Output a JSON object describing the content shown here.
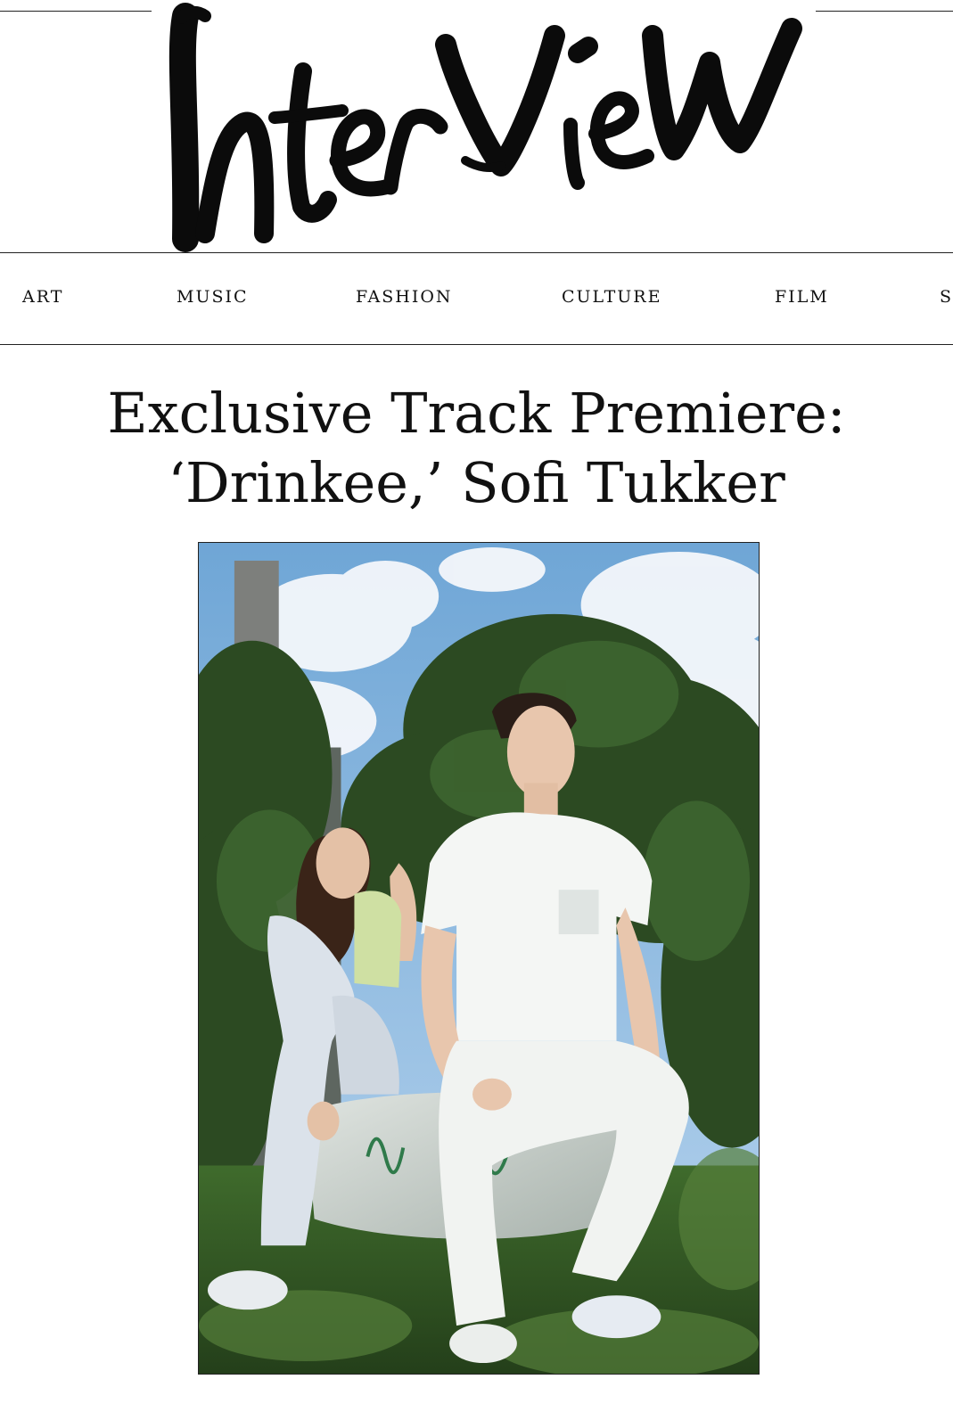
{
  "masthead": {
    "logo_text": "Interview"
  },
  "nav": {
    "items": [
      {
        "label": "ART"
      },
      {
        "label": "MUSIC"
      },
      {
        "label": "FASHION"
      },
      {
        "label": "CULTURE"
      },
      {
        "label": "FILM"
      },
      {
        "label": "S"
      }
    ]
  },
  "article": {
    "headline_line1": "Exclusive Track Premiere:",
    "headline_line2": "‘Drinkee,’ Sofi Tukker"
  }
}
